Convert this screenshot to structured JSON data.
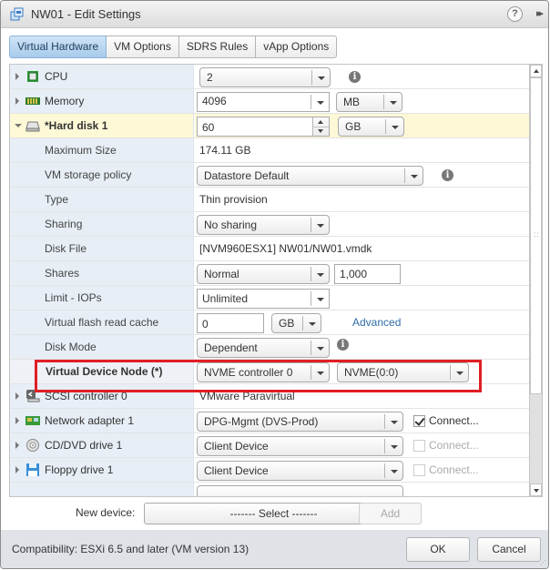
{
  "window": {
    "title": "NW01 - Edit Settings",
    "help_icon": "?",
    "expand_icon": "▸▸"
  },
  "tabs": [
    {
      "label": "Virtual Hardware",
      "active": true
    },
    {
      "label": "VM Options",
      "active": false
    },
    {
      "label": "SDRS Rules",
      "active": false
    },
    {
      "label": "vApp Options",
      "active": false
    }
  ],
  "hardware": {
    "cpu": {
      "label": "CPU",
      "icon": "cpu-icon",
      "value": "2"
    },
    "memory": {
      "label": "Memory",
      "icon": "memory-icon",
      "value": "4096",
      "unit": "MB"
    },
    "hard_disk": {
      "label": "*Hard disk 1",
      "icon": "hard-disk-icon",
      "value": "60",
      "unit": "GB",
      "max_size_label": "Maximum Size",
      "max_size_value": "174.11 GB",
      "storage_policy_label": "VM storage policy",
      "storage_policy_value": "Datastore Default",
      "type_label": "Type",
      "type_value": "Thin provision",
      "sharing_label": "Sharing",
      "sharing_value": "No sharing",
      "disk_file_label": "Disk File",
      "disk_file_value": "[NVM960ESX1] NW01/NW01.vmdk",
      "shares_label": "Shares",
      "shares_value": "Normal",
      "shares_number": "1,000",
      "limit_label": "Limit - IOPs",
      "limit_value": "Unlimited",
      "flash_label": "Virtual flash read cache",
      "flash_value": "0",
      "flash_unit": "GB",
      "advanced_link": "Advanced",
      "disk_mode_label": "Disk Mode",
      "disk_mode_value": "Dependent",
      "vdn_label": "Virtual Device Node (*)",
      "vdn_controller": "NVME controller 0",
      "vdn_node": "NVME(0:0)"
    },
    "scsi": {
      "label": "SCSI controller 0",
      "icon": "scsi-controller-icon",
      "value": "VMware Paravirtual"
    },
    "network": {
      "label": "Network adapter 1",
      "icon": "network-adapter-icon",
      "value": "DPG-Mgmt (DVS-Prod)",
      "connect_label": "Connect...",
      "connected": true
    },
    "cddvd": {
      "label": "CD/DVD drive 1",
      "icon": "cd-dvd-icon",
      "value": "Client Device",
      "connect_label": "Connect...",
      "connected": false
    },
    "floppy": {
      "label": "Floppy drive 1",
      "icon": "floppy-icon",
      "value": "Client Device",
      "connect_label": "Connect...",
      "connected": false
    }
  },
  "new_device": {
    "label": "New device:",
    "select_value": "------- Select -------",
    "add_label": "Add"
  },
  "footer": {
    "compatibility": "Compatibility: ESXi 6.5 and later (VM version 13)",
    "ok_label": "OK",
    "cancel_label": "Cancel"
  },
  "colors": {
    "highlight_box": "#e01e25",
    "active_tab": "#a7cbeb",
    "link": "#2f6ea9"
  }
}
